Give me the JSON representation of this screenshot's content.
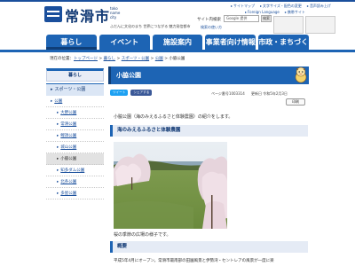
{
  "header": {
    "site_name": "常滑市",
    "site_romaji": "toko name city",
    "tagline": "ふだんに文化のまち 世界につながる 魅力発信都市",
    "util_links": [
      "サイトマップ",
      "文字サイズ・配色の変更",
      "音声読み上げ"
    ],
    "util_links2": [
      "Foreign Language",
      "携帯サイト"
    ],
    "search_label": "サイト内検索",
    "search_placeholder": "Google 提供",
    "search_button": "検索",
    "advanced_search": "検索の使い方"
  },
  "nav": {
    "items": [
      "暮らし",
      "イベント",
      "施設案内",
      "事業者向け情報",
      "市政・まちづくり"
    ]
  },
  "breadcrumb": {
    "prefix": "現在の位置：",
    "items": [
      "トップページ",
      "暮らし",
      "スポーツ・公園",
      "公園"
    ],
    "current": "小脇公園",
    "separator": " > "
  },
  "sidebar": {
    "heading": "暮らし",
    "category": "スポーツ・公園",
    "parent": "公園",
    "items": [
      "大野公園",
      "常滑公園",
      "鯉須公園",
      "城山公園",
      "小脇公園",
      "知多ダム公園",
      "北条公園",
      "多屋公園"
    ],
    "current_index": 4
  },
  "main": {
    "title": "小脇公園",
    "share_twitter": "ツイート",
    "share_facebook": "シェアする",
    "page_number": "ページ番号1003314",
    "updated": "更新日 令和5年2月3日",
    "print": "印刷",
    "intro": "小脇公園（海のみえるふるさと体験農園）の紹介をします。",
    "section1": "海のみえるふるさと体験農園",
    "caption": "桜の季節の広場の様子です。",
    "section2": "概要",
    "body": "平成5年4月にオープン。常滑市最南部の田園風景と伊勢湾・セントレアの風景が一度に楽"
  },
  "colors": {
    "brand": "#1d64b4",
    "brand_dark": "#0f3e77",
    "link": "#1a4f9c"
  }
}
